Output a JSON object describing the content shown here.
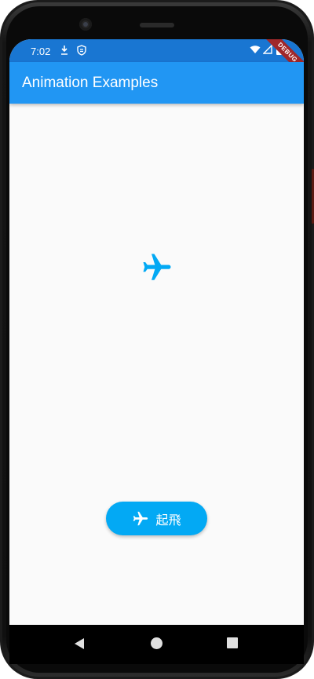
{
  "status_bar": {
    "time": "7:02",
    "debug_banner": "DEBUG",
    "color": "#1976d2"
  },
  "app_bar": {
    "title": "Animation Examples",
    "color": "#2196f3"
  },
  "main": {
    "plane_icon": "airplane-icon",
    "plane_color": "#03a9f4"
  },
  "fly_button": {
    "label": "起飛",
    "icon": "airplane-icon",
    "color": "#03a9f4"
  },
  "nav_bar": {
    "back_icon": "back-triangle-icon",
    "home_icon": "home-circle-icon",
    "recent_icon": "recents-square-icon"
  }
}
